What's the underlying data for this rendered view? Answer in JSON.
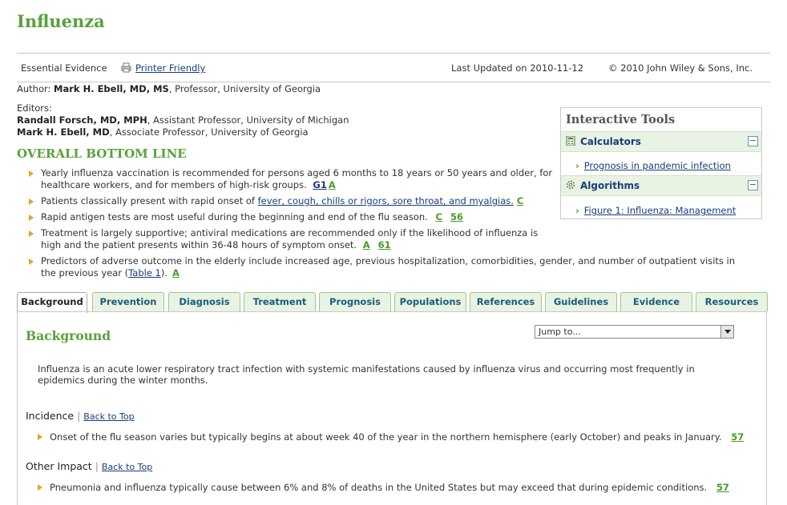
{
  "page_title": "Influenza",
  "topbar": {
    "essential_evidence": "Essential Evidence",
    "printer_friendly": "Printer Friendly",
    "last_updated": "Last Updated on 2010-11-12",
    "copyright": "© 2010 John Wiley & Sons, Inc."
  },
  "author": {
    "label": "Author:",
    "name": "Mark H. Ebell, MD, MS",
    "rest": ", Professor, University of Georgia"
  },
  "editors": {
    "label": "Editors:",
    "e1_name": "Randall Forsch, MD, MPH",
    "e1_rest": ", Assistant Professor, University of Michigan",
    "e2_name": "Mark H. Ebell, MD",
    "e2_rest": ", Associate Professor, University of Georgia"
  },
  "bottom_line": {
    "title": "OVERALL BOTTOM LINE",
    "b1_text": "Yearly influenza vaccination is recommended for persons aged 6 months to 18 years or 50 years and older, for healthcare workers, and for members of high-risk groups.",
    "b1_g1": "G1",
    "b1_grade": "A",
    "b2_pre": "Patients classically present with rapid onset of ",
    "b2_link": "fever, cough, chills or rigors, sore throat, and myalgias.",
    "b2_grade": "C",
    "b3_text": "Rapid antigen tests are most useful during the beginning and end of the flu season.",
    "b3_grade": "C",
    "b3_ref": "56",
    "b4_text": "Treatment is largely supportive; antiviral medications are recommended only if the likelihood of influenza is high and the patient presents within 36-48 hours of symptom onset.",
    "b4_grade": "A",
    "b4_ref": "61",
    "b5_pre": "Predictors of adverse outcome in the elderly include increased age, previous hospitalization, comorbidities, gender, and number of outpatient visits in the previous year (",
    "b5_link": "Table 1",
    "b5_post": ").",
    "b5_grade": "A"
  },
  "tools": {
    "title": "Interactive Tools",
    "calc_label": "Calculators",
    "calc_link": "Prognosis in pandemic infection",
    "algo_label": "Algorithms",
    "algo_link": "Figure 1: Influenza: Management",
    "minus": "−"
  },
  "tabs": [
    "Background",
    "Prevention",
    "Diagnosis",
    "Treatment",
    "Prognosis",
    "Populations",
    "References",
    "Guidelines",
    "Evidence",
    "Resources"
  ],
  "content": {
    "title": "Background",
    "jump_to": "Jump to...",
    "intro": "Influenza is an acute lower respiratory tract infection with systemic manifestations caused by influenza virus and occurring most frequently in epidemics during the winter months.",
    "incidence_label": "Incidence",
    "back_to_top": "Back to Top",
    "incidence_text": "Onset of the flu season varies but typically begins at about week 40 of the year in the northern hemisphere (early October) and peaks in January.",
    "incidence_ref": "57",
    "other_label": "Other Impact",
    "other_text": "Pneumonia and influenza typically cause between 6% and 8% of deaths in the United States but may exceed that during epidemic conditions.",
    "other_ref": "57"
  }
}
